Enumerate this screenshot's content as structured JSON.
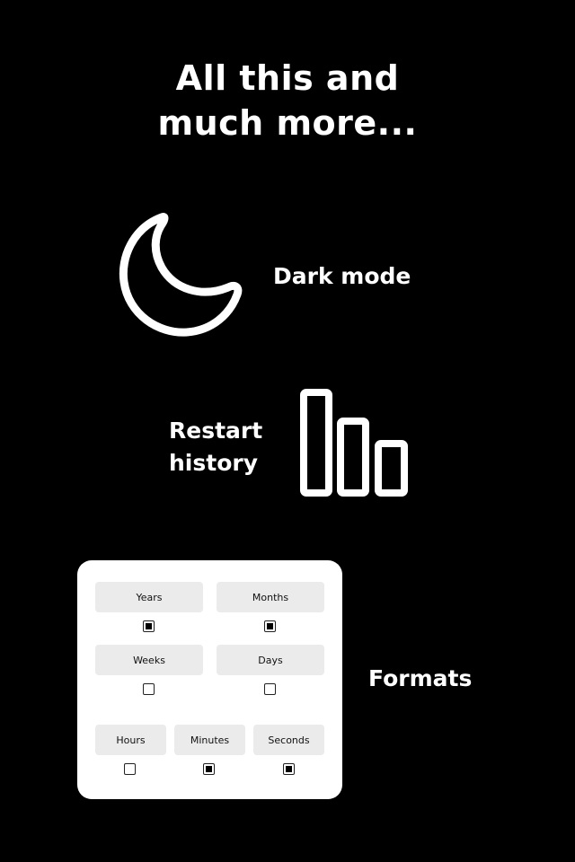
{
  "headline": {
    "line1": "All this and",
    "line2": "much more..."
  },
  "features": [
    {
      "label": "Dark mode",
      "icon": "moon-icon"
    },
    {
      "label_line1": "Restart",
      "label_line2": "history",
      "icon": "bar-chart-icon"
    },
    {
      "label": "Formats",
      "icon": "formats-card"
    }
  ],
  "formats": {
    "options": [
      {
        "label": "Years",
        "checked": true
      },
      {
        "label": "Months",
        "checked": true
      },
      {
        "label": "Weeks",
        "checked": false
      },
      {
        "label": "Days",
        "checked": false
      },
      {
        "label": "Hours",
        "checked": false
      },
      {
        "label": "Minutes",
        "checked": true
      },
      {
        "label": "Seconds",
        "checked": true
      }
    ]
  },
  "colors": {
    "background": "#000000",
    "foreground": "#ffffff",
    "chip": "#ebebeb"
  }
}
